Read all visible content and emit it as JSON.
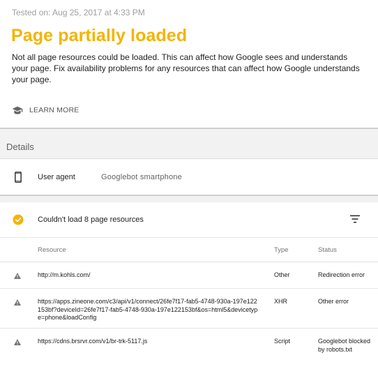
{
  "header": {
    "tested_on": "Tested on: Aug 25, 2017 at 4:33 PM",
    "title": "Page partially loaded",
    "description": "Not all page resources could be loaded. This can affect how Google sees and understands your page. Fix availability problems for any resources that can affect how Google understands your page.",
    "learn_more": "LEARN MORE",
    "title_color": "#f4b400"
  },
  "details": {
    "section_label": "Details",
    "user_agent_label": "User agent",
    "user_agent_value": "Googlebot smartphone",
    "device_icon": "smartphone-icon"
  },
  "resources": {
    "summary": "Couldn't load 8 page resources",
    "summary_icon": "check-circle-icon",
    "filter_icon": "filter-icon",
    "columns": [
      "Resource",
      "Type",
      "Status"
    ],
    "rows": [
      {
        "resource": "http://m.kohls.com/",
        "type": "Other",
        "status": "Redirection error"
      },
      {
        "resource": "https://apps.zineone.com/c3/api/v1/connect/26fe7f17-fab5-4748-930a-197e122153bf?deviceId=26fe7f17-fab5-4748-930a-197e122153bf&os=html5&devicetype=phone&loadConfig",
        "type": "XHR",
        "status": "Other error"
      },
      {
        "resource": "https://cdns.brsrvr.com/v1/br-trk-5117.js",
        "type": "Script",
        "status": "Googlebot blocked by robots.txt"
      }
    ]
  }
}
